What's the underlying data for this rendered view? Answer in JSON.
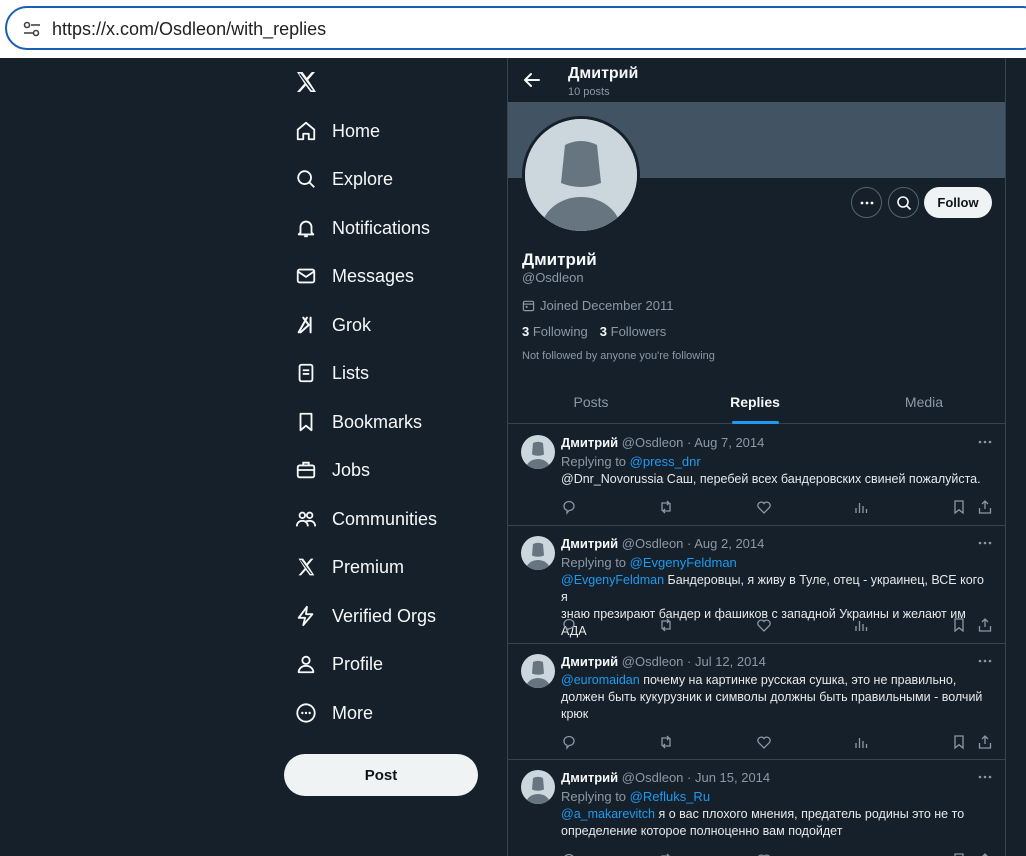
{
  "browser": {
    "url": "https://x.com/Osdleon/with_replies"
  },
  "nav": {
    "items": [
      {
        "label": "Home",
        "icon": "home-icon"
      },
      {
        "label": "Explore",
        "icon": "search-icon"
      },
      {
        "label": "Notifications",
        "icon": "bell-icon"
      },
      {
        "label": "Messages",
        "icon": "envelope-icon"
      },
      {
        "label": "Grok",
        "icon": "grok-icon"
      },
      {
        "label": "Lists",
        "icon": "list-icon"
      },
      {
        "label": "Bookmarks",
        "icon": "bookmark-icon"
      },
      {
        "label": "Jobs",
        "icon": "briefcase-icon"
      },
      {
        "label": "Communities",
        "icon": "communities-icon"
      },
      {
        "label": "Premium",
        "icon": "x-logo-icon"
      },
      {
        "label": "Verified Orgs",
        "icon": "lightning-icon"
      },
      {
        "label": "Profile",
        "icon": "person-icon"
      },
      {
        "label": "More",
        "icon": "more-circle-icon"
      }
    ],
    "post_label": "Post"
  },
  "profile": {
    "top_name": "Дмитрий",
    "top_posts": "10 posts",
    "name": "Дмитрий",
    "handle": "@Osdleon",
    "joined": "Joined December 2011",
    "following_count": "3",
    "following_label": "Following",
    "followers_count": "3",
    "followers_label": "Followers",
    "not_followed": "Not followed by anyone you're following",
    "follow_label": "Follow"
  },
  "tabs": [
    {
      "label": "Posts"
    },
    {
      "label": "Replies"
    },
    {
      "label": "Media"
    }
  ],
  "tweets": [
    {
      "name": "Дмитрий",
      "meta": "@Osdleon · Aug 7, 2014",
      "replying_prefix": "Replying to ",
      "replying_to": "@press_dnr",
      "mention": "",
      "lines": [
        "@Dnr_Novorussia Саш, перебей всех бандеровских свиней пожалуйста."
      ]
    },
    {
      "name": "Дмитрий",
      "meta": "@Osdleon · Aug 2, 2014",
      "replying_prefix": "Replying to ",
      "replying_to": "@EvgenyFeldman",
      "mention": "@EvgenyFeldman",
      "lines": [
        " Бандеровцы, я живу в Туле, отец - украинец, ВСЕ кого я",
        "знаю презирают бандер и фашиков с западной Украины и желают им АДА"
      ]
    },
    {
      "name": "Дмитрий",
      "meta": "@Osdleon · Jul 12, 2014",
      "replying_prefix": "",
      "replying_to": "",
      "mention": "@euromaidan",
      "lines": [
        " почему на картинке русская сушка, это не правильно,",
        "должен быть кукурузник и символы должны быть правильными - волчий",
        "крюк"
      ]
    },
    {
      "name": "Дмитрий",
      "meta": "@Osdleon · Jun 15, 2014",
      "replying_prefix": "Replying to ",
      "replying_to": "@Refluks_Ru",
      "mention": "@a_makarevitch",
      "lines": [
        " я о вас плохого мнения, предатель родины это не то",
        "определение которое полноценно вам подойдет"
      ]
    }
  ]
}
